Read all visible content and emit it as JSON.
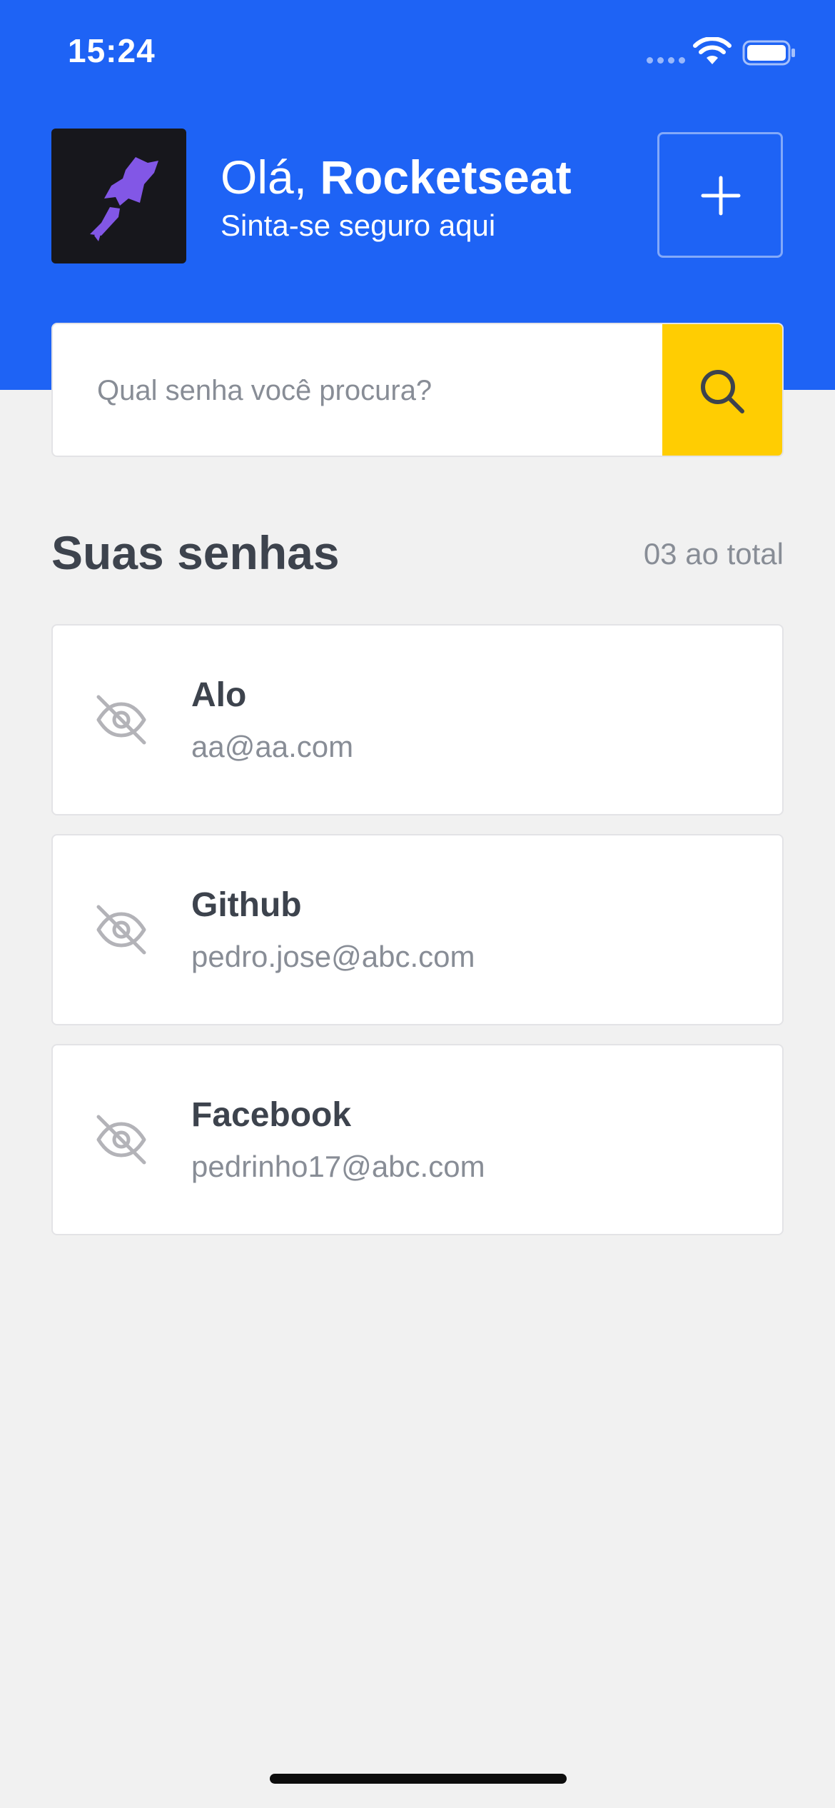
{
  "status_bar": {
    "time": "15:24"
  },
  "header": {
    "greeting_prefix": "Olá, ",
    "user_name": "Rocketseat",
    "subtitle": "Sinta-se seguro aqui",
    "add_button_icon": "plus-icon"
  },
  "search": {
    "placeholder": "Qual senha você procura?",
    "value": "",
    "button_icon": "search-icon"
  },
  "section": {
    "title": "Suas senhas",
    "count": "03 ao total"
  },
  "passwords": [
    {
      "title": "Alo",
      "email": "aa@aa.com",
      "icon": "eye-off-icon"
    },
    {
      "title": "Github",
      "email": "pedro.jose@abc.com",
      "icon": "eye-off-icon"
    },
    {
      "title": "Facebook",
      "email": "pedrinho17@abc.com",
      "icon": "eye-off-icon"
    }
  ],
  "colors": {
    "header_background": "#1e63f5",
    "search_button": "#ffcd02",
    "page_background": "#f1f1f1",
    "text_primary": "#3d434d",
    "text_secondary": "#888d96",
    "avatar_background": "#17171c",
    "avatar_accent": "#8257e6"
  }
}
